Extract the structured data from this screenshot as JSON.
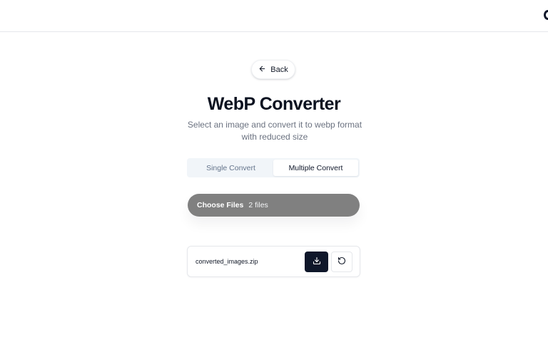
{
  "header": {
    "edge_icon": "partial-logo-icon"
  },
  "back": {
    "label": "Back",
    "icon": "arrow-left-icon"
  },
  "page": {
    "title": "WebP Converter",
    "subtitle": "Select an image and convert it to webp format with reduced size"
  },
  "tabs": [
    {
      "label": "Single Convert",
      "active": false
    },
    {
      "label": "Multiple Convert",
      "active": true
    }
  ],
  "file_input": {
    "button_label": "Choose Files",
    "status": "2 files"
  },
  "result": {
    "file_name": "converted_images.zip",
    "download_icon": "download-icon",
    "reset_icon": "rotate-ccw-icon"
  },
  "colors": {
    "primary": "#0f172a",
    "file_input_bg": "#808080",
    "muted_text": "#6b7280"
  }
}
